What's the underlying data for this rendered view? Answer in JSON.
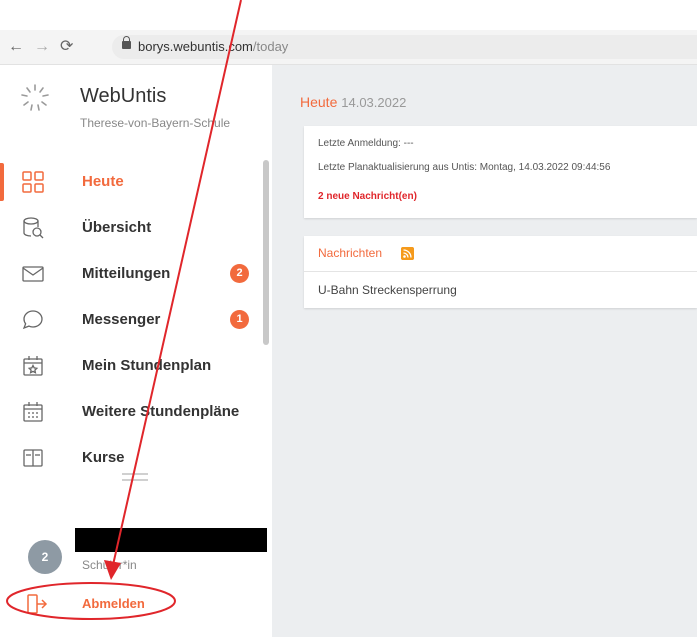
{
  "browser": {
    "url_main": "borys.webuntis.com",
    "url_path": "/today"
  },
  "app": {
    "title": "WebUntis",
    "school": "Therese-von-Bayern-Schule"
  },
  "sidebar": {
    "items": [
      {
        "label": "Heute",
        "icon": "today-grid-icon",
        "active": true
      },
      {
        "label": "Übersicht",
        "icon": "overview-icon"
      },
      {
        "label": "Mitteilungen",
        "icon": "envelope-icon",
        "badge": "2"
      },
      {
        "label": "Messenger",
        "icon": "chat-bubble-icon",
        "badge": "1"
      },
      {
        "label": "Mein Stundenplan",
        "icon": "calendar-star-icon"
      },
      {
        "label": "Weitere Stundenpläne",
        "icon": "calendar-grid-icon"
      },
      {
        "label": "Kurse",
        "icon": "book-icon"
      }
    ],
    "user": {
      "avatar_number": "2",
      "role": "Schüler*in",
      "logout_label": "Abmelden"
    }
  },
  "main": {
    "title": "Heute",
    "date": "14.03.2022",
    "status": {
      "last_login": "Letzte Anmeldung: ---",
      "last_update": "Letzte Planaktualisierung aus Untis: Montag, 14.03.2022 09:44:56",
      "new_messages": "2 neue Nachricht(en)"
    },
    "news": {
      "header": "Nachrichten",
      "items": [
        "U-Bahn Streckensperrung"
      ]
    }
  },
  "colors": {
    "accent": "#f26a3d",
    "annotation": "#e0262b"
  }
}
